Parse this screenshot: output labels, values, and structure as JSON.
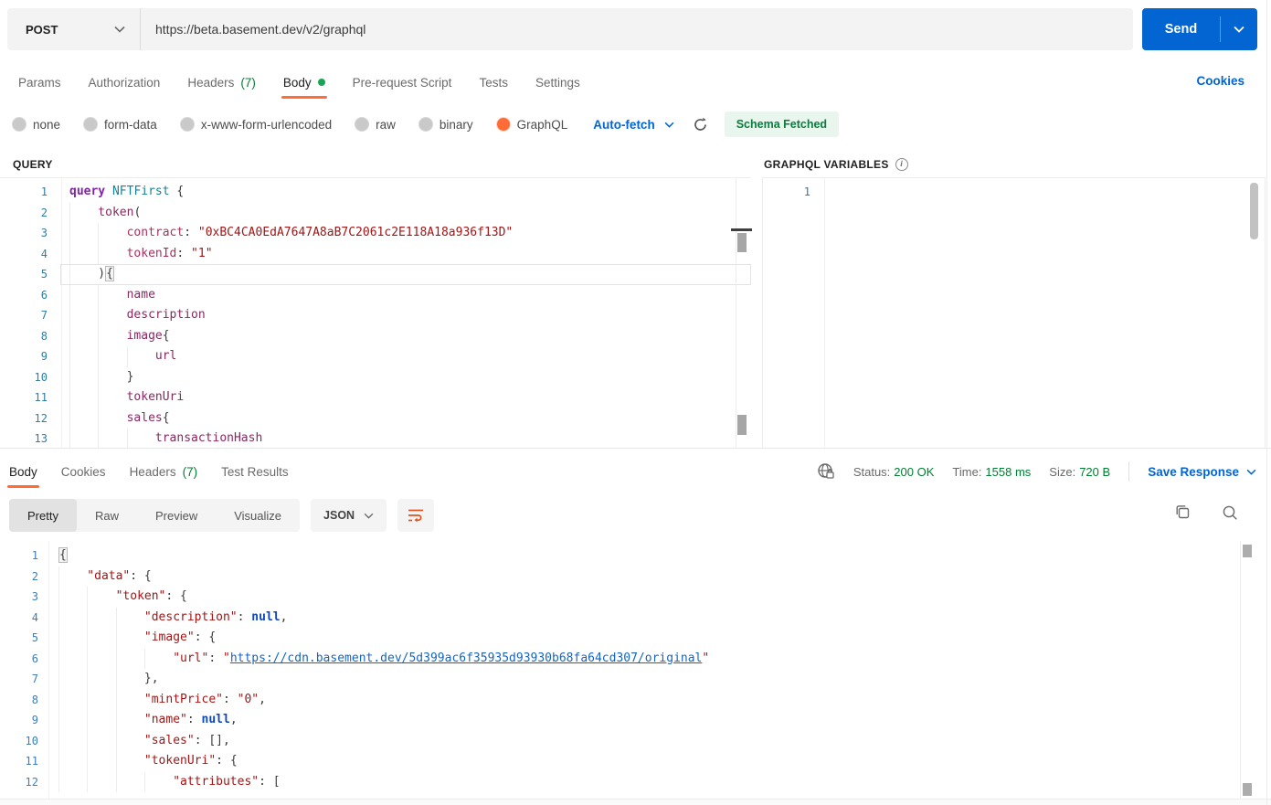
{
  "colors": {
    "accent_orange": "#ff6c37",
    "primary_blue": "#0265d2",
    "success_green": "#007f31"
  },
  "request_bar": {
    "method": "POST",
    "url": "https://beta.basement.dev/v2/graphql",
    "send_label": "Send"
  },
  "request_tabs": {
    "items": [
      {
        "label": "Params"
      },
      {
        "label": "Authorization"
      },
      {
        "label": "Headers",
        "badge": "(7)"
      },
      {
        "label": "Body",
        "dot": true,
        "active": true
      },
      {
        "label": "Pre-request Script"
      },
      {
        "label": "Tests"
      },
      {
        "label": "Settings"
      }
    ],
    "cookies_link": "Cookies"
  },
  "body_modes": {
    "options": [
      {
        "label": "none"
      },
      {
        "label": "form-data"
      },
      {
        "label": "x-www-form-urlencoded"
      },
      {
        "label": "raw"
      },
      {
        "label": "binary"
      },
      {
        "label": "GraphQL",
        "selected": true
      }
    ],
    "autofetch_label": "Auto-fetch",
    "schema_badge": "Schema Fetched"
  },
  "query_panel": {
    "title": "QUERY",
    "lines": [
      {
        "n": 1,
        "tokens": [
          [
            "kw",
            "query"
          ],
          [
            "t",
            " "
          ],
          [
            "op",
            "NFTFirst"
          ],
          [
            "t",
            " {"
          ]
        ]
      },
      {
        "n": 2,
        "tokens": [
          [
            "i",
            4
          ],
          [
            "fld",
            "token"
          ],
          [
            "t",
            "("
          ]
        ]
      },
      {
        "n": 3,
        "tokens": [
          [
            "i",
            8
          ],
          [
            "arg",
            "contract"
          ],
          [
            "t",
            ": "
          ],
          [
            "str",
            "\"0xBC4CA0EdA7647A8aB7C2061c2E118A18a936f13D\""
          ]
        ]
      },
      {
        "n": 4,
        "tokens": [
          [
            "i",
            8
          ],
          [
            "arg",
            "tokenId"
          ],
          [
            "t",
            ": "
          ],
          [
            "str",
            "\"1\""
          ]
        ]
      },
      {
        "n": 5,
        "cur": true,
        "tokens": [
          [
            "i",
            4
          ],
          [
            "t",
            ")"
          ],
          [
            "brk",
            "{"
          ]
        ]
      },
      {
        "n": 6,
        "tokens": [
          [
            "i",
            8
          ],
          [
            "fld",
            "name"
          ]
        ]
      },
      {
        "n": 7,
        "tokens": [
          [
            "i",
            8
          ],
          [
            "fld",
            "description"
          ]
        ]
      },
      {
        "n": 8,
        "tokens": [
          [
            "i",
            8
          ],
          [
            "fld",
            "image"
          ],
          [
            "t",
            "{"
          ]
        ]
      },
      {
        "n": 9,
        "tokens": [
          [
            "i",
            12
          ],
          [
            "fld",
            "url"
          ]
        ]
      },
      {
        "n": 10,
        "tokens": [
          [
            "i",
            8
          ],
          [
            "t",
            "}"
          ]
        ]
      },
      {
        "n": 11,
        "tokens": [
          [
            "i",
            8
          ],
          [
            "fld",
            "tokenUri"
          ]
        ]
      },
      {
        "n": 12,
        "tokens": [
          [
            "i",
            8
          ],
          [
            "fld",
            "sales"
          ],
          [
            "t",
            "{"
          ]
        ]
      },
      {
        "n": 13,
        "tokens": [
          [
            "i",
            12
          ],
          [
            "fld",
            "transactionHash"
          ]
        ]
      }
    ]
  },
  "variables_panel": {
    "title": "GRAPHQL VARIABLES",
    "lines": [
      {
        "n": 1,
        "tokens": []
      }
    ]
  },
  "response_tabs": {
    "items": [
      {
        "label": "Body",
        "active": true
      },
      {
        "label": "Cookies"
      },
      {
        "label": "Headers",
        "badge": "(7)"
      },
      {
        "label": "Test Results"
      }
    ]
  },
  "response_meta": {
    "status_label": "Status:",
    "status_value": "200 OK",
    "time_label": "Time:",
    "time_value": "1558 ms",
    "size_label": "Size:",
    "size_value": "720 B",
    "save_label": "Save Response"
  },
  "response_toolbar": {
    "views": [
      {
        "label": "Pretty",
        "active": true
      },
      {
        "label": "Raw"
      },
      {
        "label": "Preview"
      },
      {
        "label": "Visualize"
      }
    ],
    "format_label": "JSON"
  },
  "response_body": {
    "lines": [
      {
        "n": 1,
        "tokens": [
          [
            "brk",
            "{"
          ]
        ]
      },
      {
        "n": 2,
        "tokens": [
          [
            "i",
            4
          ],
          [
            "key",
            "\"data\""
          ],
          [
            "t",
            ": {"
          ]
        ]
      },
      {
        "n": 3,
        "tokens": [
          [
            "i",
            8
          ],
          [
            "key",
            "\"token\""
          ],
          [
            "t",
            ": {"
          ]
        ]
      },
      {
        "n": 4,
        "tokens": [
          [
            "i",
            12
          ],
          [
            "key",
            "\"description\""
          ],
          [
            "t",
            ": "
          ],
          [
            "nul",
            "null"
          ],
          [
            "t",
            ","
          ]
        ]
      },
      {
        "n": 5,
        "tokens": [
          [
            "i",
            12
          ],
          [
            "key",
            "\"image\""
          ],
          [
            "t",
            ": {"
          ]
        ]
      },
      {
        "n": 6,
        "tokens": [
          [
            "i",
            16
          ],
          [
            "key",
            "\"url\""
          ],
          [
            "t",
            ": "
          ],
          [
            "str",
            "\""
          ],
          [
            "lnk",
            "https://cdn.basement.dev/5d399ac6f35935d93930b68fa64cd307/original"
          ],
          [
            "str",
            "\""
          ]
        ]
      },
      {
        "n": 7,
        "tokens": [
          [
            "i",
            12
          ],
          [
            "t",
            "},"
          ]
        ]
      },
      {
        "n": 8,
        "tokens": [
          [
            "i",
            12
          ],
          [
            "key",
            "\"mintPrice\""
          ],
          [
            "t",
            ": "
          ],
          [
            "str",
            "\"0\""
          ],
          [
            "t",
            ","
          ]
        ]
      },
      {
        "n": 9,
        "tokens": [
          [
            "i",
            12
          ],
          [
            "key",
            "\"name\""
          ],
          [
            "t",
            ": "
          ],
          [
            "nul",
            "null"
          ],
          [
            "t",
            ","
          ]
        ]
      },
      {
        "n": 10,
        "tokens": [
          [
            "i",
            12
          ],
          [
            "key",
            "\"sales\""
          ],
          [
            "t",
            ": [],"
          ]
        ]
      },
      {
        "n": 11,
        "tokens": [
          [
            "i",
            12
          ],
          [
            "key",
            "\"tokenUri\""
          ],
          [
            "t",
            ": {"
          ]
        ]
      },
      {
        "n": 12,
        "tokens": [
          [
            "i",
            16
          ],
          [
            "key",
            "\"attributes\""
          ],
          [
            "t",
            ": ["
          ]
        ]
      }
    ]
  }
}
